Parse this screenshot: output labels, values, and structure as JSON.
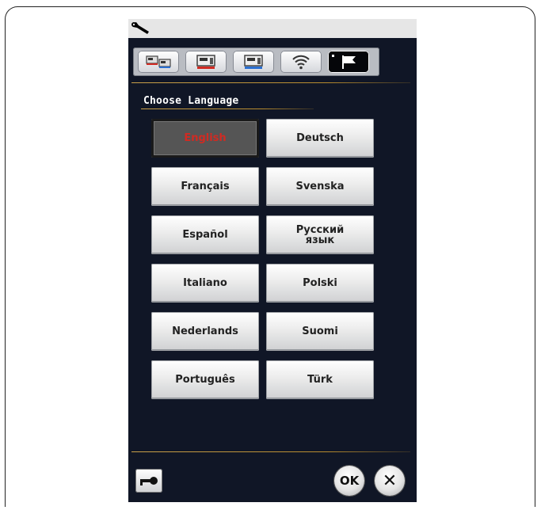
{
  "header": {
    "settings_icon": "wrench-icon",
    "tabs": [
      {
        "icon": "machine-settings-icon",
        "active": false
      },
      {
        "icon": "sewing-settings-icon",
        "active": false
      },
      {
        "icon": "embroidery-settings-icon",
        "active": false
      },
      {
        "icon": "wireless-icon",
        "active": false
      },
      {
        "icon": "flag-icon",
        "active": true
      }
    ]
  },
  "main": {
    "heading": "Choose Language",
    "languages": [
      {
        "label": "English",
        "selected": true
      },
      {
        "label": "Deutsch",
        "selected": false
      },
      {
        "label": "Français",
        "selected": false
      },
      {
        "label": "Svenska",
        "selected": false
      },
      {
        "label": "Español",
        "selected": false
      },
      {
        "label": "Русский язык",
        "selected": false
      },
      {
        "label": "Italiano",
        "selected": false
      },
      {
        "label": "Polski",
        "selected": false
      },
      {
        "label": "Nederlands",
        "selected": false
      },
      {
        "label": "Suomi",
        "selected": false
      },
      {
        "label": "Português",
        "selected": false
      },
      {
        "label": "Türk",
        "selected": false
      }
    ]
  },
  "footer": {
    "lock_icon": "key-icon",
    "ok_label": "OK",
    "close_label": "✕"
  },
  "colors": {
    "screen_bg": "#101626",
    "selected_text": "#d12a22",
    "rule_gold": "#c9a04a"
  }
}
